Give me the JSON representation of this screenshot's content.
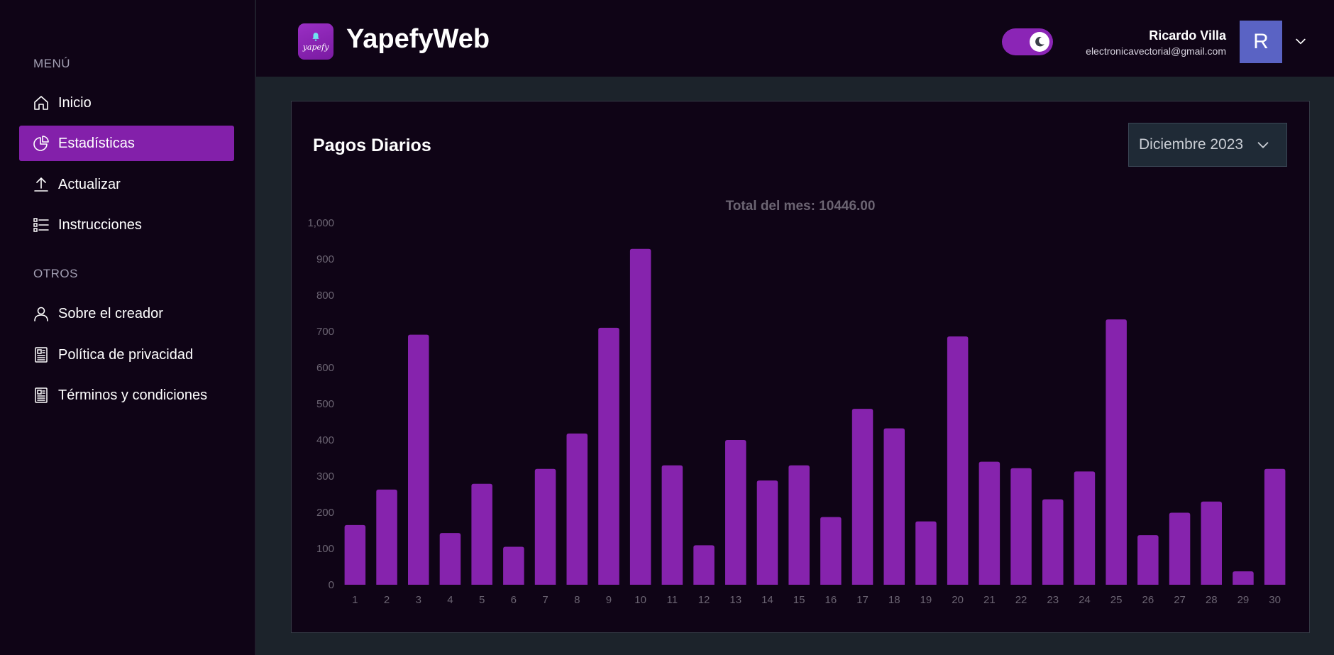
{
  "sidebar": {
    "menu_title": "MENÚ",
    "menu_items": [
      {
        "label": "Inicio",
        "icon": "home-icon"
      },
      {
        "label": "Estadísticas",
        "icon": "pie-chart-icon",
        "active": true
      },
      {
        "label": "Actualizar",
        "icon": "upload-icon"
      },
      {
        "label": "Instrucciones",
        "icon": "list-icon"
      }
    ],
    "others_title": "OTROS",
    "other_items": [
      {
        "label": "Sobre el creador",
        "icon": "user-icon"
      },
      {
        "label": "Política de privacidad",
        "icon": "document-icon"
      },
      {
        "label": "Términos y condiciones",
        "icon": "document-icon"
      }
    ]
  },
  "header": {
    "app_title": "YapefyWeb",
    "logo_text": "yapefy",
    "user_name": "Ricardo Villa",
    "user_email": "electronicavectorial@gmail.com",
    "avatar_initial": "R",
    "theme_toggle": "dark-mode"
  },
  "card": {
    "title": "Pagos Diarios",
    "month_selected": "Diciembre 2023"
  },
  "colors": {
    "accent": "#8320aa",
    "bar": "#8623ad",
    "background": "#0f0416",
    "page_background": "#1c232b"
  },
  "chart_data": {
    "type": "bar",
    "title": "Total del mes: 10446.00",
    "categories": [
      "1",
      "2",
      "3",
      "4",
      "5",
      "6",
      "7",
      "8",
      "9",
      "10",
      "11",
      "12",
      "13",
      "14",
      "15",
      "16",
      "17",
      "18",
      "19",
      "20",
      "21",
      "22",
      "23",
      "24",
      "25",
      "26",
      "27",
      "28",
      "29",
      "30"
    ],
    "values": [
      165,
      263,
      691,
      143,
      279,
      105,
      320,
      418,
      710,
      928,
      330,
      109,
      400,
      288,
      330,
      187,
      486,
      432,
      175,
      686,
      340,
      322,
      236,
      313,
      733,
      137,
      199,
      230,
      37,
      320
    ],
    "ylim": [
      0,
      1000
    ],
    "yticks": [
      "0",
      "100",
      "200",
      "300",
      "400",
      "500",
      "600",
      "700",
      "800",
      "900",
      "1,000"
    ],
    "grid": false,
    "legend": "none"
  }
}
